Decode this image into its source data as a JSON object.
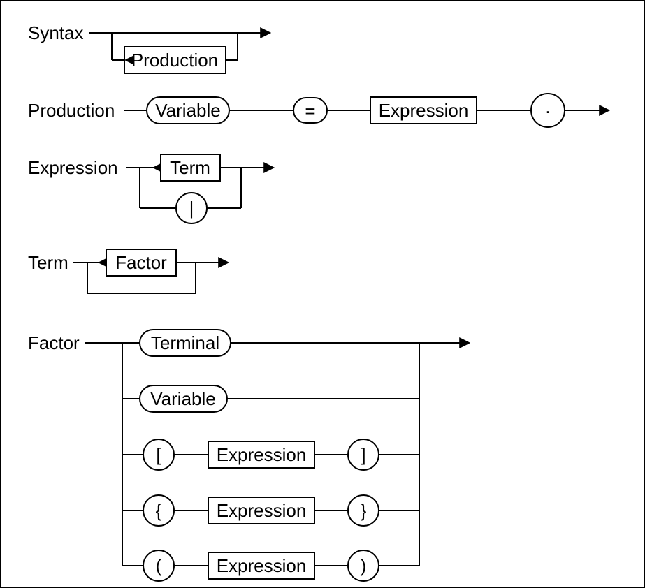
{
  "rules": {
    "syntax": {
      "label": "Syntax",
      "nodes": {
        "production": "Production"
      }
    },
    "production": {
      "label": "Production",
      "nodes": {
        "variable": "Variable",
        "equals": "=",
        "expression": "Expression",
        "dot": "."
      }
    },
    "expression": {
      "label": "Expression",
      "nodes": {
        "term": "Term",
        "pipe": "|"
      }
    },
    "term": {
      "label": "Term",
      "nodes": {
        "factor": "Factor"
      }
    },
    "factor": {
      "label": "Factor",
      "alts": {
        "terminal": "Terminal",
        "variable": "Variable",
        "opt": {
          "open": "[",
          "body": "Expression",
          "close": "]"
        },
        "rep": {
          "open": "{",
          "body": "Expression",
          "close": "}"
        },
        "grp": {
          "open": "(",
          "body": "Expression",
          "close": ")"
        }
      }
    }
  }
}
